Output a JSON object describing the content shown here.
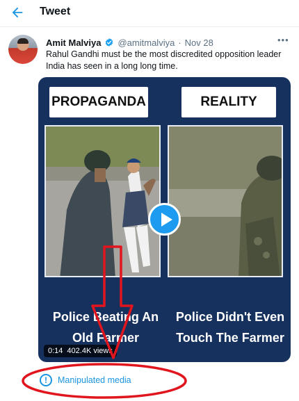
{
  "header": {
    "back_icon": "arrow-left-icon",
    "title": "Tweet"
  },
  "tweet": {
    "author_name": "Amit Malviya",
    "verified_icon": "verified-badge-icon",
    "handle": "@amitmalviya",
    "separator": "·",
    "date": "Nov 28",
    "more_icon": "more-options-icon",
    "text": "Rahul Gandhi must be the most discredited opposition leader India has seen in a long long time."
  },
  "media": {
    "left_label": "PROPAGANDA",
    "right_label": "REALITY",
    "left_caption": "Police Beating An Old Farmer",
    "right_caption": "Police Didn't Even Touch The Farmer",
    "play_icon": "play-icon",
    "time": "0:14",
    "views": "402.4K views"
  },
  "warning": {
    "icon": "info-circle-icon",
    "label": "Manipulated media"
  },
  "colors": {
    "accent": "#1b95e0",
    "annotation_red": "#e0151e",
    "media_bg": "#17315e"
  }
}
